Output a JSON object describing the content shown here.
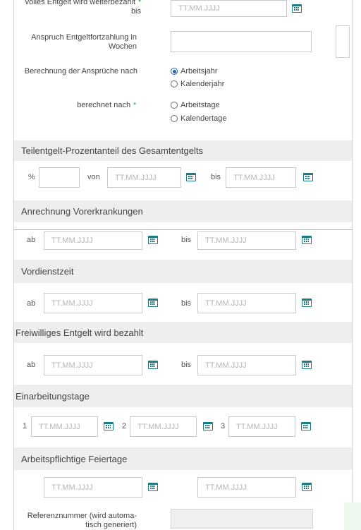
{
  "placeholder_date": "TT.MM.JJJJ",
  "colors": {
    "accent": "#1d7b86",
    "section_bg": "#eeeeee",
    "radio_selected": "#1e5fa8",
    "required": "#2a8a3a"
  },
  "top": {
    "voll_label_line1": "volles Entgelt wird weiterbezahlt",
    "voll_label_line2": "bis",
    "anspruch_label_line1": "Anspruch Entgeltfortzahlung in",
    "anspruch_label_line2": "Wochen",
    "berechnung_label": "Berechnung der Ansprüche nach",
    "berechnung_options": [
      "Arbeitsjahr",
      "Kalenderjahr"
    ],
    "berechnet_label": "berechnet nach",
    "berechnet_options": [
      "Arbeitstage",
      "Kalendertage"
    ],
    "required_mark": "*"
  },
  "teilentgelt": {
    "title": "Teilentgelt-Prozentanteil des Gesamtentgelts",
    "percent_label": "%",
    "von_label": "von",
    "bis_label": "bis"
  },
  "vorerkrankungen": {
    "title": "Anrechnung Vorerkrankungen",
    "ab_label": "ab",
    "bis_label": "bis"
  },
  "vordienstzeit": {
    "title": "Vordienstzeit",
    "ab_label": "ab",
    "bis_label": "bis"
  },
  "freiwillig": {
    "title": "Freiwilliges Entgelt wird bezahlt",
    "ab_label": "ab",
    "bis_label": "bis"
  },
  "einarbeitung": {
    "title": "Einarbeitungstage",
    "labels": [
      "1",
      "2",
      "3"
    ]
  },
  "feiertage": {
    "title": "Arbeitspflichtige Feiertage"
  },
  "referenz": {
    "label_line1": "Referenznummer (wird automa-",
    "label_line2": "tisch generiert)"
  }
}
